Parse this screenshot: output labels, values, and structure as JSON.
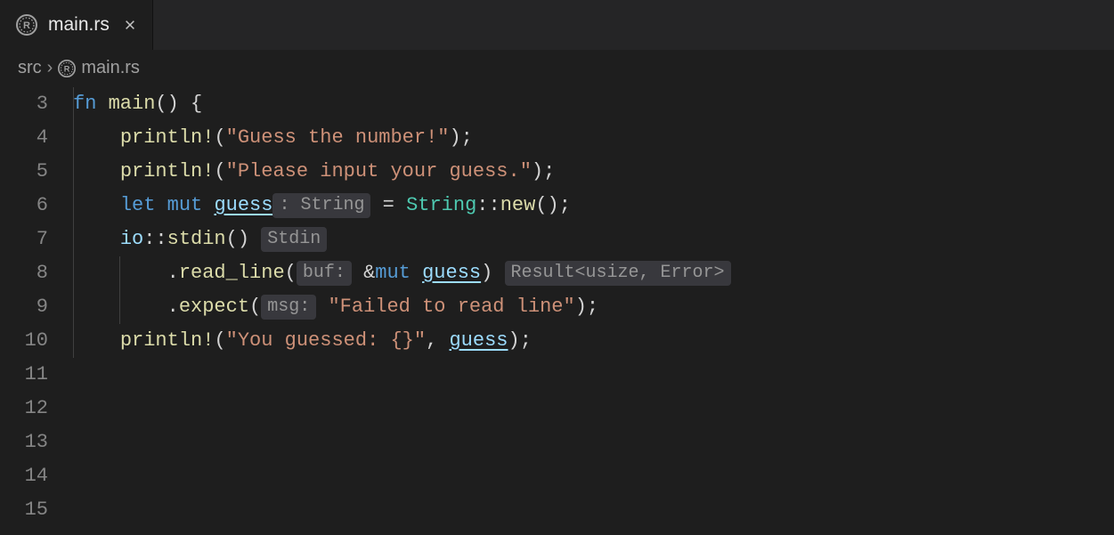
{
  "tab": {
    "filename": "main.rs",
    "icon": "rust-icon"
  },
  "breadcrumb": {
    "folder": "src",
    "file": "main.rs"
  },
  "editor": {
    "first_line_number": 3,
    "lines": [
      {
        "num": "3",
        "indent": 0,
        "guide_inner": false,
        "tokens": [
          [
            "c-kw",
            "fn"
          ],
          [
            "c-plain",
            " "
          ],
          [
            "c-fn",
            "main"
          ],
          [
            "c-punct",
            "()"
          ],
          [
            "c-plain",
            " "
          ],
          [
            "c-punct",
            "{"
          ]
        ]
      },
      {
        "num": "4",
        "indent": 1,
        "guide_inner": false,
        "tokens": [
          [
            "c-fn",
            "println!"
          ],
          [
            "c-punct",
            "("
          ],
          [
            "c-str",
            "\"Guess the number!\""
          ],
          [
            "c-punct",
            ");"
          ]
        ]
      },
      {
        "num": "5",
        "indent": 0,
        "guide_inner": false,
        "tokens": []
      },
      {
        "num": "6",
        "indent": 1,
        "guide_inner": false,
        "tokens": [
          [
            "c-fn",
            "println!"
          ],
          [
            "c-punct",
            "("
          ],
          [
            "c-str",
            "\"Please input your guess.\""
          ],
          [
            "c-punct",
            ");"
          ]
        ]
      },
      {
        "num": "7",
        "indent": 0,
        "guide_inner": false,
        "tokens": []
      },
      {
        "num": "8",
        "indent": 1,
        "guide_inner": false,
        "tokens": [
          [
            "c-kw",
            "let"
          ],
          [
            "c-plain",
            " "
          ],
          [
            "c-kw",
            "mut"
          ],
          [
            "c-plain",
            " "
          ],
          [
            "c-var underline",
            "guess"
          ],
          [
            "hint",
            ": String"
          ],
          [
            "c-plain",
            " "
          ],
          [
            "c-punct",
            "="
          ],
          [
            "c-plain",
            " "
          ],
          [
            "c-type",
            "String"
          ],
          [
            "c-punct",
            "::"
          ],
          [
            "c-fn",
            "new"
          ],
          [
            "c-punct",
            "();"
          ]
        ]
      },
      {
        "num": "9",
        "indent": 0,
        "guide_inner": false,
        "tokens": []
      },
      {
        "num": "10",
        "indent": 1,
        "guide_inner": false,
        "tokens": [
          [
            "c-var",
            "io"
          ],
          [
            "c-punct",
            "::"
          ],
          [
            "c-fn",
            "stdin"
          ],
          [
            "c-punct",
            "()"
          ],
          [
            "c-plain",
            " "
          ],
          [
            "hint",
            "Stdin"
          ]
        ]
      },
      {
        "num": "11",
        "indent": 2,
        "guide_inner": true,
        "tokens": [
          [
            "c-punct",
            "."
          ],
          [
            "c-fn",
            "read_line"
          ],
          [
            "c-punct",
            "("
          ],
          [
            "hint-complex",
            "buf"
          ],
          [
            "c-plain",
            " "
          ],
          [
            "c-punct",
            "&"
          ],
          [
            "c-kw",
            "mut"
          ],
          [
            "c-plain",
            " "
          ],
          [
            "c-var underline",
            "guess"
          ],
          [
            "c-punct",
            ")"
          ],
          [
            "c-plain",
            " "
          ],
          [
            "hint",
            "Result<usize, Error>"
          ]
        ]
      },
      {
        "num": "12",
        "indent": 2,
        "guide_inner": true,
        "tokens": [
          [
            "c-punct",
            "."
          ],
          [
            "c-fn",
            "expect"
          ],
          [
            "c-punct",
            "("
          ],
          [
            "hint-complex",
            "msg"
          ],
          [
            "c-plain",
            " "
          ],
          [
            "c-str",
            "\"Failed to read line\""
          ],
          [
            "c-punct",
            ");"
          ]
        ]
      },
      {
        "num": "13",
        "indent": 0,
        "guide_inner": true,
        "tokens": []
      },
      {
        "num": "14",
        "indent": 1,
        "guide_inner": false,
        "tokens": [
          [
            "c-fn",
            "println!"
          ],
          [
            "c-punct",
            "("
          ],
          [
            "c-str",
            "\"You guessed: {}\""
          ],
          [
            "c-punct",
            ","
          ],
          [
            "c-plain",
            " "
          ],
          [
            "c-var underline",
            "guess"
          ],
          [
            "c-punct",
            ");"
          ]
        ]
      },
      {
        "num": "15",
        "indent": 0,
        "guide_inner": false,
        "tokens": []
      }
    ]
  }
}
